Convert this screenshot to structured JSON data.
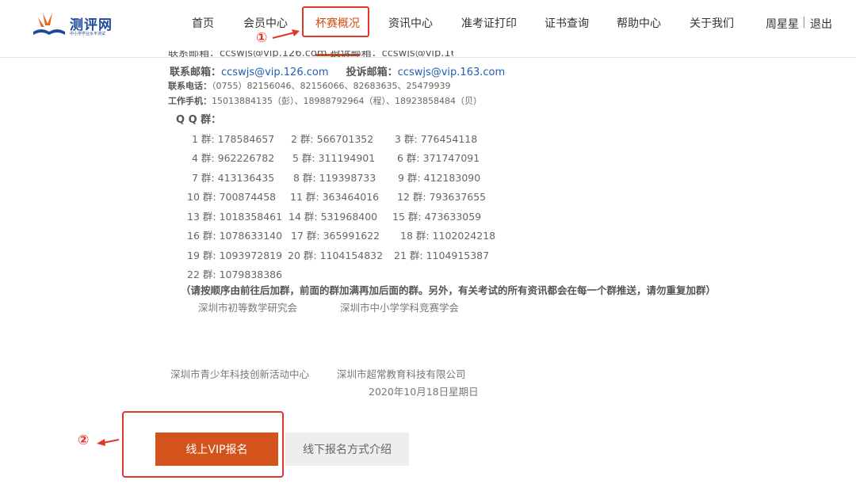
{
  "header": {
    "logo_text": "测评网",
    "logo_sub": "中小学学业水平测试",
    "nav": [
      {
        "label": "首页"
      },
      {
        "label": "会员中心"
      },
      {
        "label": "杯赛概况"
      },
      {
        "label": "资讯中心"
      },
      {
        "label": "准考证打印"
      },
      {
        "label": "证书查询"
      },
      {
        "label": "帮助中心"
      },
      {
        "label": "关于我们"
      }
    ],
    "user": "周星星",
    "separator": "|",
    "logout": "退出"
  },
  "markers": {
    "first": "①",
    "second": "②"
  },
  "contact": {
    "email_label": "联系邮箱：",
    "email": "ccswjs@vip.126.com",
    "complaint_label": "投诉邮箱：",
    "complaint_email": "ccswjs@vip.163.com",
    "phone_label": "联系电话：",
    "phone": "（0755）82156046、82156066、82683635、25479939",
    "mobile_label": "工作手机：",
    "mobile": "15013884135（彭）、18988792964（程）、18923858484（贝）"
  },
  "qq": {
    "title": "Q  Q 群：",
    "groups": [
      "1 群: 178584657",
      "2 群:  566701352",
      "3 群: 776454118",
      "4 群:  962226782",
      "5 群:  311194901",
      "6 群: 371747091",
      "7 群:  413136435",
      "8 群:  119398733",
      "9 群: 412183090",
      "10 群:  700874458",
      "11 群:  363464016",
      "12 群: 793637655",
      "13 群: 1018358461",
      "14 群:  531968400",
      "15 群: 473633059",
      "16 群:  1078633140",
      "17 群:   365991622",
      "18 群: 1102024218",
      "19 群:  1093972819",
      "20 群:  1104154832",
      "21 群: 1104915387",
      "22 群:  1079838386"
    ]
  },
  "notice": "（请按顺序由前往后加群，前面的群加满再加后面的群。另外，有关考试的所有资讯都会在每一个群推送，请勿重复加群）",
  "orgs": {
    "org1": "深圳市初等数学研究会",
    "org2": "深圳市中小学学科竞赛学会",
    "org3": "深圳市青少年科技创新活动中心",
    "org4": "深圳市超常教育科技有限公司",
    "date": "2020年10月18日星期日"
  },
  "buttons": {
    "vip": "线上VIP报名",
    "offline": "线下报名方式介绍"
  },
  "colors": {
    "accent": "#d4521b",
    "annotation_red": "#e2362a",
    "link_blue": "#1f5fb0"
  }
}
